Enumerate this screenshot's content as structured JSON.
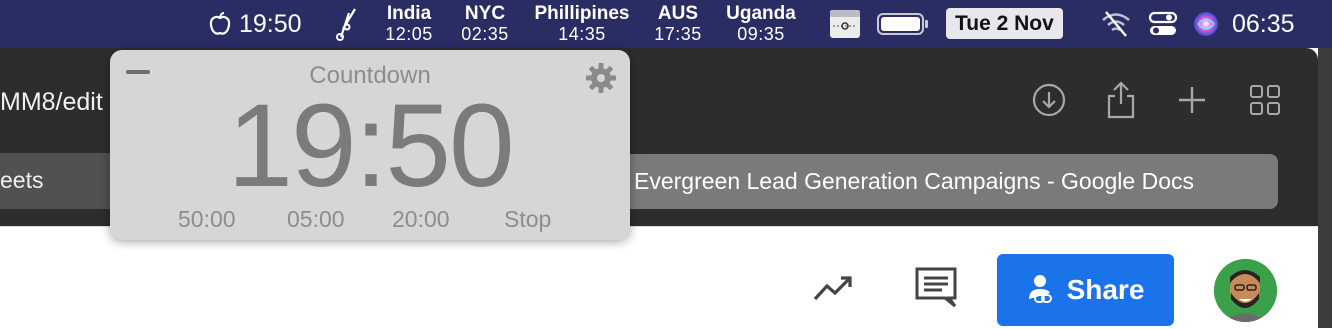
{
  "menubar": {
    "timer_value": "19:50",
    "clocks": [
      {
        "name": "India",
        "time": "12:05"
      },
      {
        "name": "NYC",
        "time": "02:35"
      },
      {
        "name": "Phillipines",
        "time": "14:35"
      },
      {
        "name": "AUS",
        "time": "17:35"
      },
      {
        "name": "Uganda",
        "time": "09:35"
      }
    ],
    "date": "Tue 2 Nov",
    "time": "06:35"
  },
  "browser": {
    "url_fragment": "MM8/edit",
    "left_tab_fragment": "eets",
    "active_tab_title": "Evergreen Lead Generation Campaigns - Google Docs"
  },
  "docs": {
    "share_label": "Share"
  },
  "countdown": {
    "title": "Countdown",
    "time": "19:50",
    "options": [
      "50:00",
      "05:00",
      "20:00",
      "Stop"
    ]
  },
  "colors": {
    "menubar_bg": "#2a2c64",
    "browser_bg": "#2d2d2f",
    "share_button": "#1a73e8",
    "widget_bg": "#d6d6d8"
  }
}
